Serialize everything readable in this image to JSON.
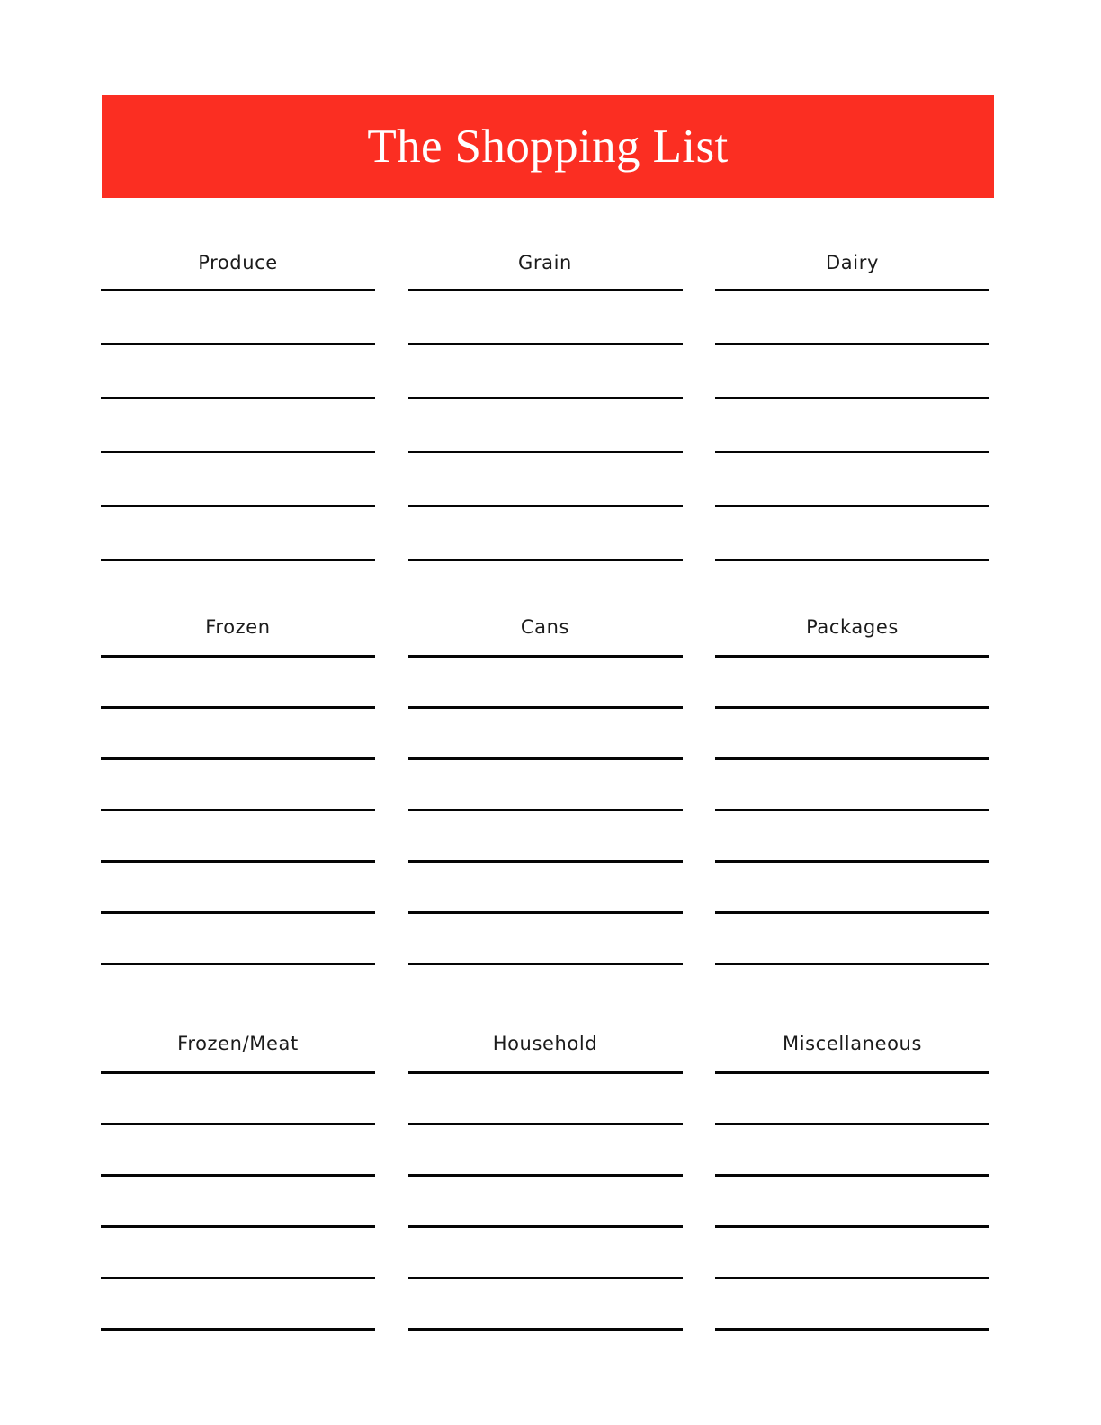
{
  "document": {
    "title": "The Shopping List",
    "banner_color": "#fb2e22",
    "title_color": "#ffffff",
    "line_color": "#050505",
    "page_background": "#ffffff"
  },
  "sections": [
    {
      "id": "section-produce",
      "columns": [
        {
          "id": "column-produce",
          "header": "Produce",
          "line_count": 6
        },
        {
          "id": "column-grain",
          "header": "Grain",
          "line_count": 6
        },
        {
          "id": "column-dairy",
          "header": "Dairy",
          "line_count": 6
        }
      ]
    },
    {
      "id": "section-frozen",
      "columns": [
        {
          "id": "column-frozen",
          "header": "Frozen",
          "line_count": 7
        },
        {
          "id": "column-cans",
          "header": "Cans",
          "line_count": 7
        },
        {
          "id": "column-packages",
          "header": "Packages",
          "line_count": 7
        }
      ]
    },
    {
      "id": "section-meat",
      "columns": [
        {
          "id": "column-frozen-meat",
          "header": "Frozen/Meat",
          "line_count": 6
        },
        {
          "id": "column-household",
          "header": "Household",
          "line_count": 6
        },
        {
          "id": "column-miscellaneous",
          "header": "Miscellaneous",
          "line_count": 6
        }
      ]
    }
  ]
}
